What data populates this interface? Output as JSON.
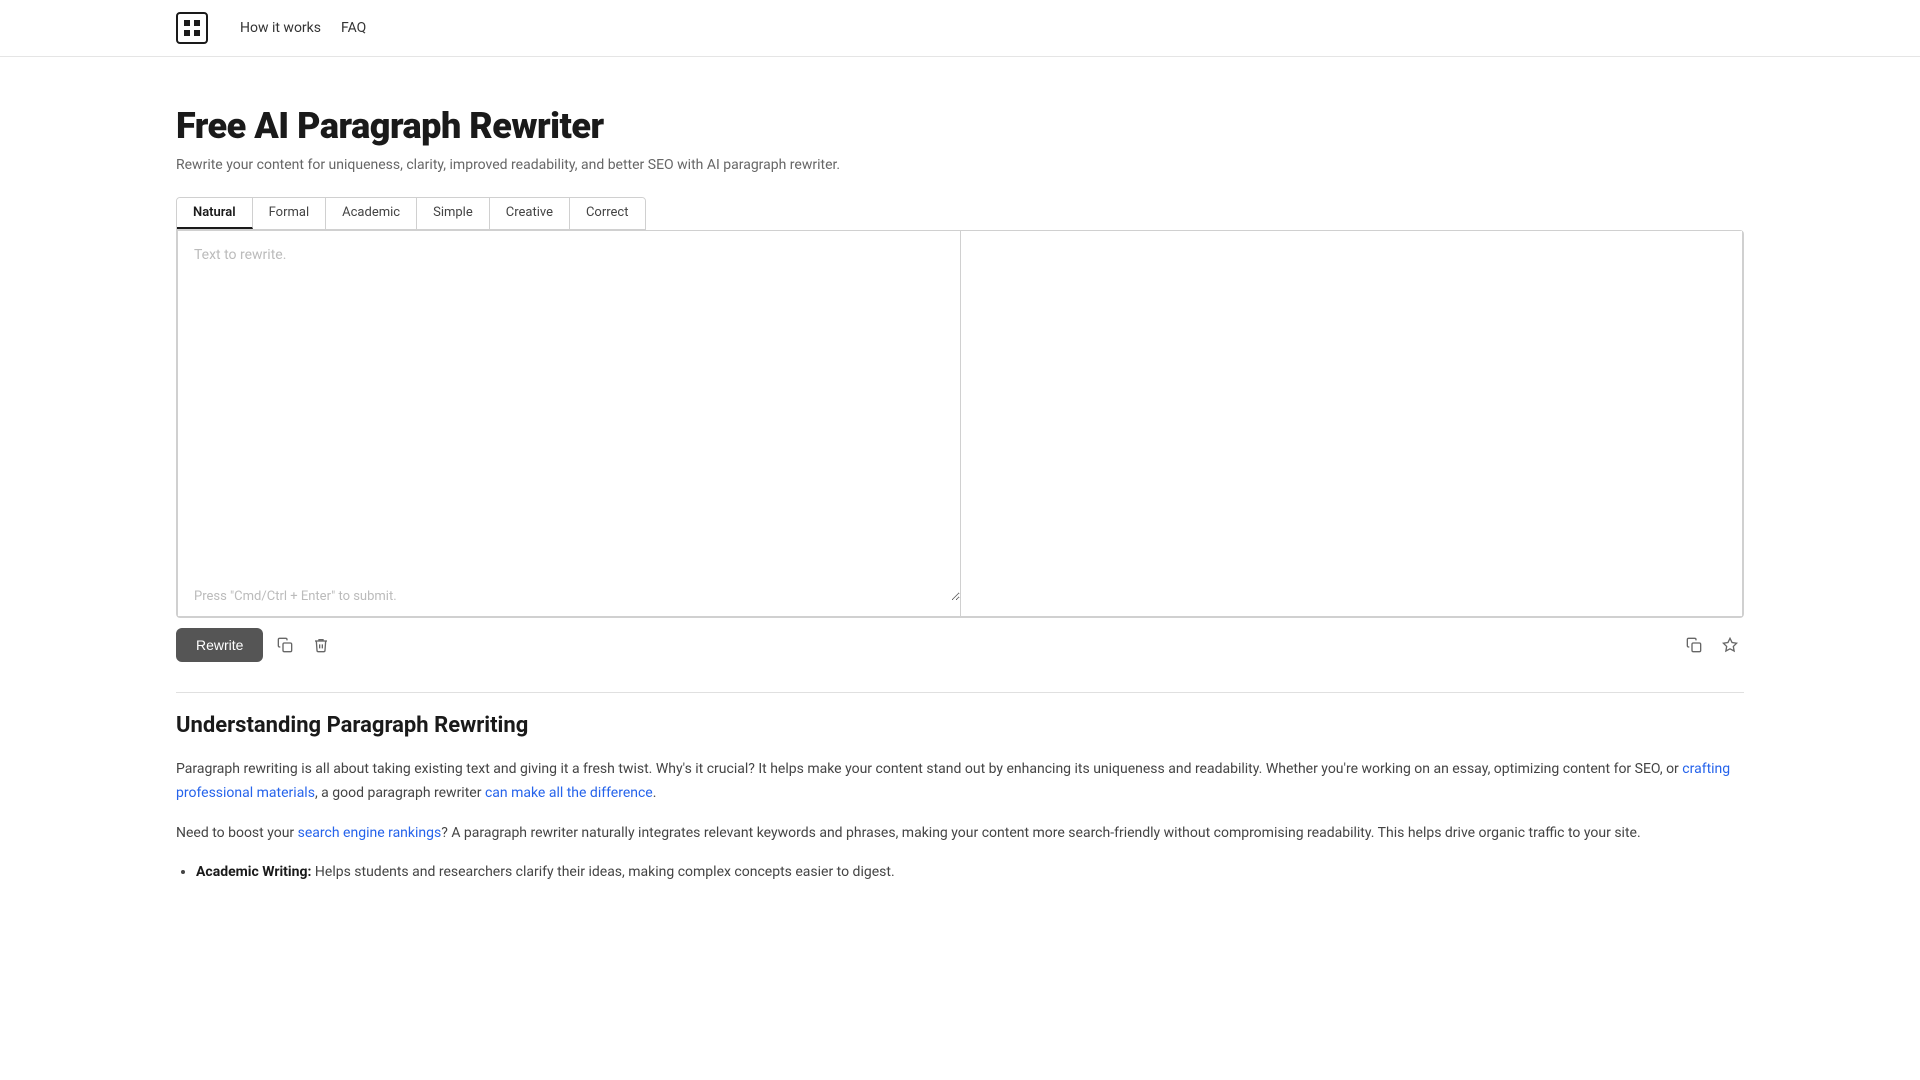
{
  "nav": {
    "logo_text": "⊞",
    "links": [
      {
        "label": "How it works",
        "name": "how-it-works"
      },
      {
        "label": "FAQ",
        "name": "faq"
      }
    ]
  },
  "hero": {
    "title": "Free AI Paragraph Rewriter",
    "subtitle": "Rewrite your content for uniqueness, clarity, improved readability, and better SEO with AI paragraph rewriter."
  },
  "tabs": [
    {
      "label": "Natural",
      "active": true
    },
    {
      "label": "Formal",
      "active": false
    },
    {
      "label": "Academic",
      "active": false
    },
    {
      "label": "Simple",
      "active": false
    },
    {
      "label": "Creative",
      "active": false
    },
    {
      "label": "Correct",
      "active": false
    }
  ],
  "editor": {
    "input_placeholder_line1": "Text to rewrite.",
    "input_placeholder_line2": "Press \"Cmd/Ctrl + Enter\" to submit."
  },
  "toolbar": {
    "rewrite_label": "Rewrite",
    "copy_tooltip": "Copy",
    "delete_tooltip": "Delete",
    "copy_output_tooltip": "Copy output",
    "magic_tooltip": "Enhance"
  },
  "info_section": {
    "title": "Understanding Paragraph Rewriting",
    "paragraph1": "Paragraph rewriting is all about taking existing text and giving it a fresh twist. Why's it crucial? It helps make your content stand out by enhancing its uniqueness and readability. Whether you're working on an essay, optimizing content for SEO, or crafting professional materials, a good paragraph rewriter can make all the difference.",
    "paragraph1_links": [
      "crafting professional materials",
      "can make all the difference"
    ],
    "paragraph2": "Need to boost your search engine rankings? A paragraph rewriter naturally integrates relevant keywords and phrases, making your content more search-friendly without compromising readability. This helps drive organic traffic to your site.",
    "paragraph2_links": [
      "search engine rankings"
    ],
    "list_intro": "",
    "list_items": [
      {
        "bold": "Academic Writing:",
        "text": " Helps students and researchers clarify their ideas, making complex concepts easier to digest."
      }
    ]
  }
}
